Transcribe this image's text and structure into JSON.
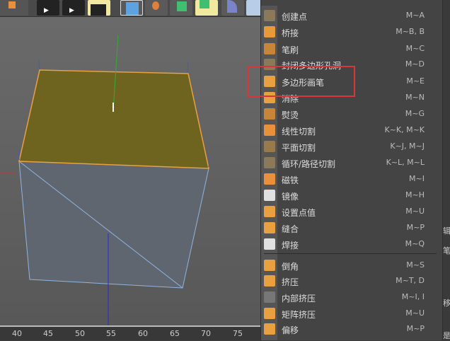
{
  "menu": {
    "items": [
      {
        "label": "创建点",
        "shortcut": "M~A",
        "icon": "create-point-icon",
        "color": "#8a7a5a"
      },
      {
        "label": "桥接",
        "shortcut": "M~B, B",
        "icon": "bridge-icon",
        "color": "#e89a3a"
      },
      {
        "label": "笔刷",
        "shortcut": "M~C",
        "icon": "brush-icon",
        "color": "#c7853a"
      },
      {
        "label": "封闭多边形孔洞",
        "shortcut": "M~D",
        "icon": "close-polygon-hole-icon",
        "color": "#8a7a5a"
      },
      {
        "label": "多边形画笔",
        "shortcut": "M~E",
        "icon": "polygon-pen-icon",
        "color": "#e8a040"
      },
      {
        "label": "消除",
        "shortcut": "M~N",
        "icon": "dissolve-icon",
        "color": "#e8a040"
      },
      {
        "label": "熨烫",
        "shortcut": "M~G",
        "icon": "iron-icon",
        "color": "#c7853a"
      },
      {
        "label": "线性切割",
        "shortcut": "K~K, M~K",
        "icon": "knife-icon",
        "color": "#e8903a"
      },
      {
        "label": "平面切割",
        "shortcut": "K~J, M~J",
        "icon": "plane-cut-icon",
        "color": "#9a7a4a"
      },
      {
        "label": "循环/路径切割",
        "shortcut": "K~L, M~L",
        "icon": "loop-cut-icon",
        "color": "#8a7a5a"
      },
      {
        "label": "磁铁",
        "shortcut": "M~I",
        "icon": "magnet-icon",
        "color": "#e8903a"
      },
      {
        "label": "镜像",
        "shortcut": "M~H",
        "icon": "mirror-icon",
        "color": "#e0e0e0"
      },
      {
        "label": "设置点值",
        "shortcut": "M~U",
        "icon": "set-point-value-icon",
        "color": "#e8a040"
      },
      {
        "label": "缝合",
        "shortcut": "M~P",
        "icon": "stitch-icon",
        "color": "#e8a040"
      },
      {
        "label": "焊接",
        "shortcut": "M~Q",
        "icon": "weld-icon",
        "color": "#e0e0e0"
      },
      {
        "label": "倒角",
        "shortcut": "M~S",
        "icon": "bevel-icon",
        "color": "#e8a040"
      },
      {
        "label": "挤压",
        "shortcut": "M~T, D",
        "icon": "extrude-icon",
        "color": "#e8a040"
      },
      {
        "label": "内部挤压",
        "shortcut": "M~I, I",
        "icon": "extrude-inner-icon",
        "color": "#777"
      },
      {
        "label": "矩阵挤压",
        "shortcut": "M~U",
        "icon": "matrix-extrude-icon",
        "color": "#e8a040"
      },
      {
        "label": "偏移",
        "shortcut": "M~P",
        "icon": "offset-icon",
        "color": "#e8a040"
      }
    ],
    "highlighted": "多边形画笔",
    "highlight_color": "#d9363b"
  },
  "ruler": {
    "labels": [
      "40",
      "45",
      "50",
      "55",
      "60",
      "65",
      "70",
      "75"
    ]
  },
  "side_panel": {
    "chars": [
      "辑",
      "笔",
      "移",
      "是"
    ]
  },
  "viewport": {
    "top_face_color": "#6e6420",
    "edge_color": "#e8a040",
    "side_face_color": "#5f6670"
  }
}
